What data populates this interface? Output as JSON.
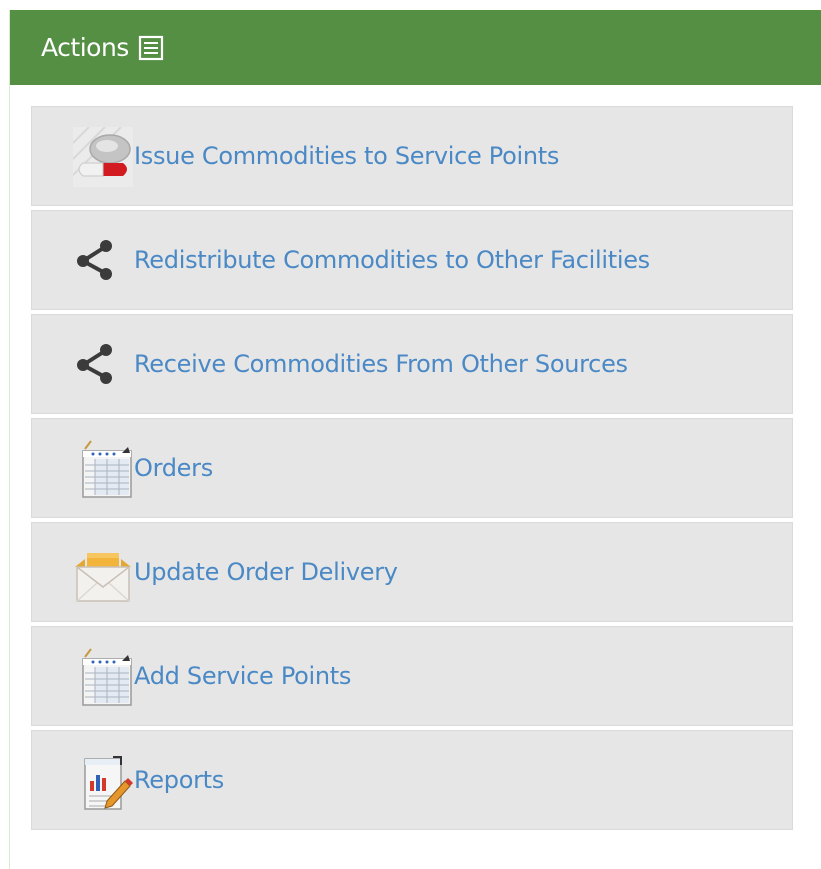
{
  "header": {
    "title": "Actions",
    "icon": "list-icon",
    "background": "#548f44"
  },
  "actions": [
    {
      "label": "Issue Commodities to Service Points",
      "icon": "pill-capsule-icon"
    },
    {
      "label": "Redistribute Commodities to Other Facilities",
      "icon": "share-icon"
    },
    {
      "label": "Receive Commodities From Other Sources",
      "icon": "share-icon"
    },
    {
      "label": "Orders",
      "icon": "spreadsheet-icon"
    },
    {
      "label": "Update Order Delivery",
      "icon": "open-box-icon"
    },
    {
      "label": "Add Service Points",
      "icon": "spreadsheet-icon"
    },
    {
      "label": "Reports",
      "icon": "report-chart-icon"
    }
  ],
  "colors": {
    "link": "#4a89c5",
    "item_background": "#e6e6e6"
  }
}
